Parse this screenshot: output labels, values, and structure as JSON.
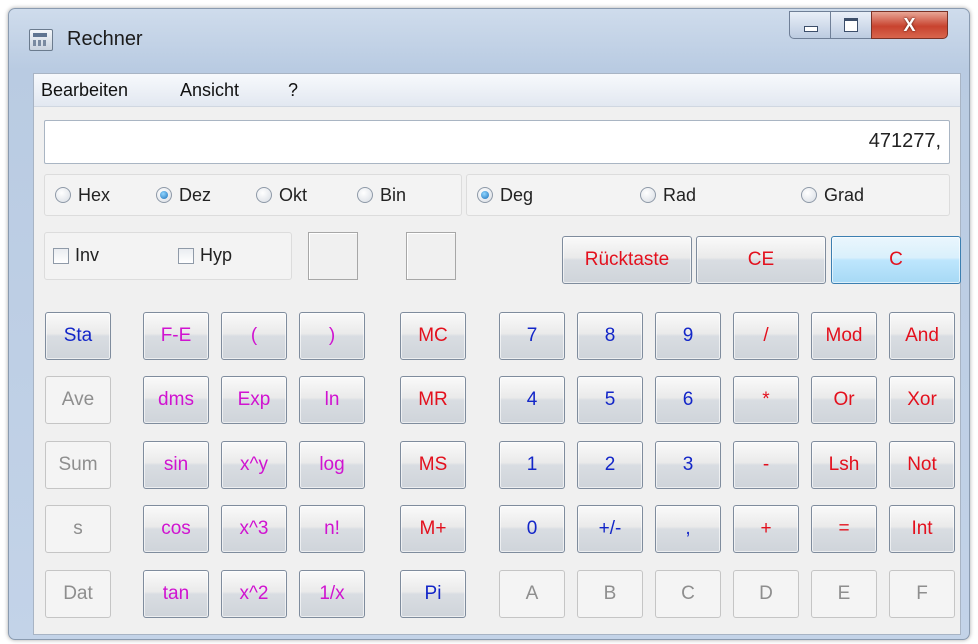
{
  "window": {
    "title": "Rechner",
    "close_glyph": "X"
  },
  "menu": [
    "Bearbeiten",
    "Ansicht",
    "?"
  ],
  "display": {
    "value": "471277,"
  },
  "number_system": {
    "options": [
      "Hex",
      "Dez",
      "Okt",
      "Bin"
    ],
    "selected": "Dez"
  },
  "angle_mode": {
    "options": [
      "Deg",
      "Rad",
      "Grad"
    ],
    "selected": "Deg"
  },
  "modifiers": {
    "inv": "Inv",
    "hyp": "Hyp"
  },
  "edit_buttons": [
    "Rücktaste",
    "CE",
    "C"
  ],
  "stat_buttons": [
    "Sta",
    "Ave",
    "Sum",
    "s",
    "Dat"
  ],
  "sci_buttons": [
    [
      "F-E",
      "(",
      ")"
    ],
    [
      "dms",
      "Exp",
      "ln"
    ],
    [
      "sin",
      "x^y",
      "log"
    ],
    [
      "cos",
      "x^3",
      "n!"
    ],
    [
      "tan",
      "x^2",
      "1/x"
    ]
  ],
  "memory_buttons": [
    "MC",
    "MR",
    "MS",
    "M+",
    "Pi"
  ],
  "keypad": [
    [
      "7",
      "8",
      "9",
      "/",
      "Mod",
      "And"
    ],
    [
      "4",
      "5",
      "6",
      "*",
      "Or",
      "Xor"
    ],
    [
      "1",
      "2",
      "3",
      "-",
      "Lsh",
      "Not"
    ],
    [
      "0",
      "+/-",
      ",",
      "+",
      "=",
      "Int"
    ],
    [
      "A",
      "B",
      "C",
      "D",
      "E",
      "F"
    ]
  ],
  "colors": {
    "blue": "#1326c8",
    "red": "#e3101d",
    "magenta": "#d013d0",
    "disabled": "#8e8e8e",
    "accent": "#bee6fd"
  }
}
